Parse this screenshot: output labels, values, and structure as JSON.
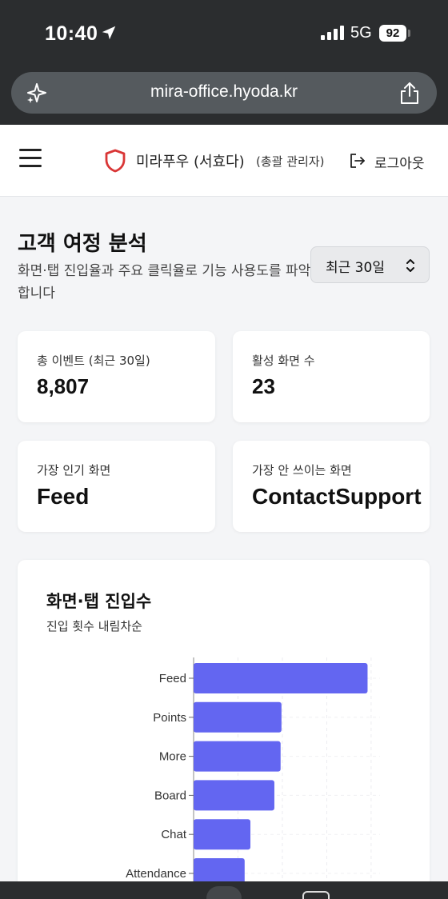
{
  "status_bar": {
    "time": "10:40",
    "network": "5G",
    "battery": "92"
  },
  "browser": {
    "url": "mira-office.hyoda.kr"
  },
  "header": {
    "brand": "미라푸우 (서효다)",
    "role": "(총괄 관리자)",
    "logout_label": "로그아웃"
  },
  "page": {
    "title": "고객 여정 분석",
    "subtitle": "화면·탭 진입율과 주요 클릭율로 기능 사용도를 파악합니다",
    "range_select": "최근 30일"
  },
  "stats": {
    "total_events_label": "총 이벤트 (최근 30일)",
    "total_events_value": "8,807",
    "active_screens_label": "활성 화면 수",
    "active_screens_value": "23",
    "most_popular_label": "가장 인기 화면",
    "most_popular_value": "Feed",
    "least_used_label": "가장 안 쓰이는 화면",
    "least_used_value": "ContactSupport"
  },
  "colors": {
    "bar": "#6366f1",
    "shield": "#d93636"
  },
  "chart_data": {
    "type": "bar",
    "orientation": "horizontal",
    "title": "화면·탭 진입수",
    "subtitle": "진입 횟수 내림차순",
    "categories": [
      "Feed",
      "Points",
      "More",
      "Board",
      "Chat",
      "Attendance"
    ],
    "values": [
      1960,
      990,
      980,
      910,
      640,
      575
    ],
    "xlim": [
      0,
      2100
    ],
    "grid": true
  }
}
